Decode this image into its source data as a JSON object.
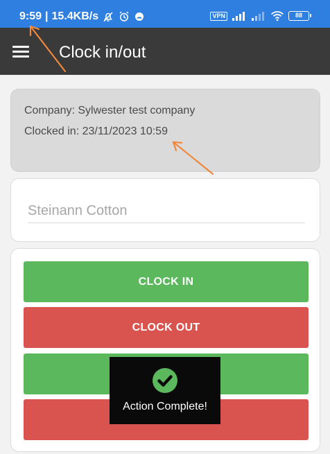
{
  "status_bar": {
    "time": "9:59",
    "network_speed": "15.4KB/s",
    "vpn": "VPN",
    "battery": "88",
    "icons": [
      "muted-bell-icon",
      "alarm-icon",
      "app-notification-icon",
      "signal-icon",
      "wifi-icon",
      "battery-icon"
    ]
  },
  "app_bar": {
    "title": "Clock in/out",
    "menu_icon": "hamburger-menu-icon"
  },
  "info": {
    "company_line": "Company: Sylwester test company",
    "clocked_in_line": "Clocked in: 23/11/2023 10:59"
  },
  "name_field": {
    "placeholder": "Steinann Cotton"
  },
  "buttons": {
    "clock_in": "CLOCK IN",
    "clock_out": "CLOCK OUT"
  },
  "toast": {
    "message": "Action Complete!",
    "icon": "check-circle-icon"
  },
  "colors": {
    "status_bar": "#2f7fe0",
    "app_bar": "#3a3a3a",
    "green": "#5cb85c",
    "red": "#d9534f",
    "annotation_arrow": "#f0883e"
  }
}
